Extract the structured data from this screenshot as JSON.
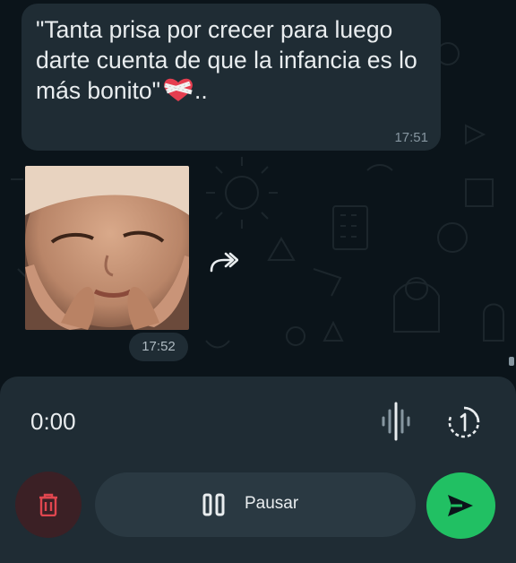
{
  "chat": {
    "message_text": "\"Tanta prisa por crecer para luego darte cuenta de que la infancia es lo más bonito\"",
    "message_trailing": "..",
    "message_emoji": "heart-with-bandage-icon",
    "message_time": "17:51",
    "sticker_time": "17:52"
  },
  "recorder": {
    "timer": "0:00",
    "pause_label": "Pausar"
  },
  "colors": {
    "background": "#0b141a",
    "bubble": "#1f2c34",
    "panel": "#1f2c34",
    "send": "#21c063",
    "delete": "#e0464f"
  }
}
